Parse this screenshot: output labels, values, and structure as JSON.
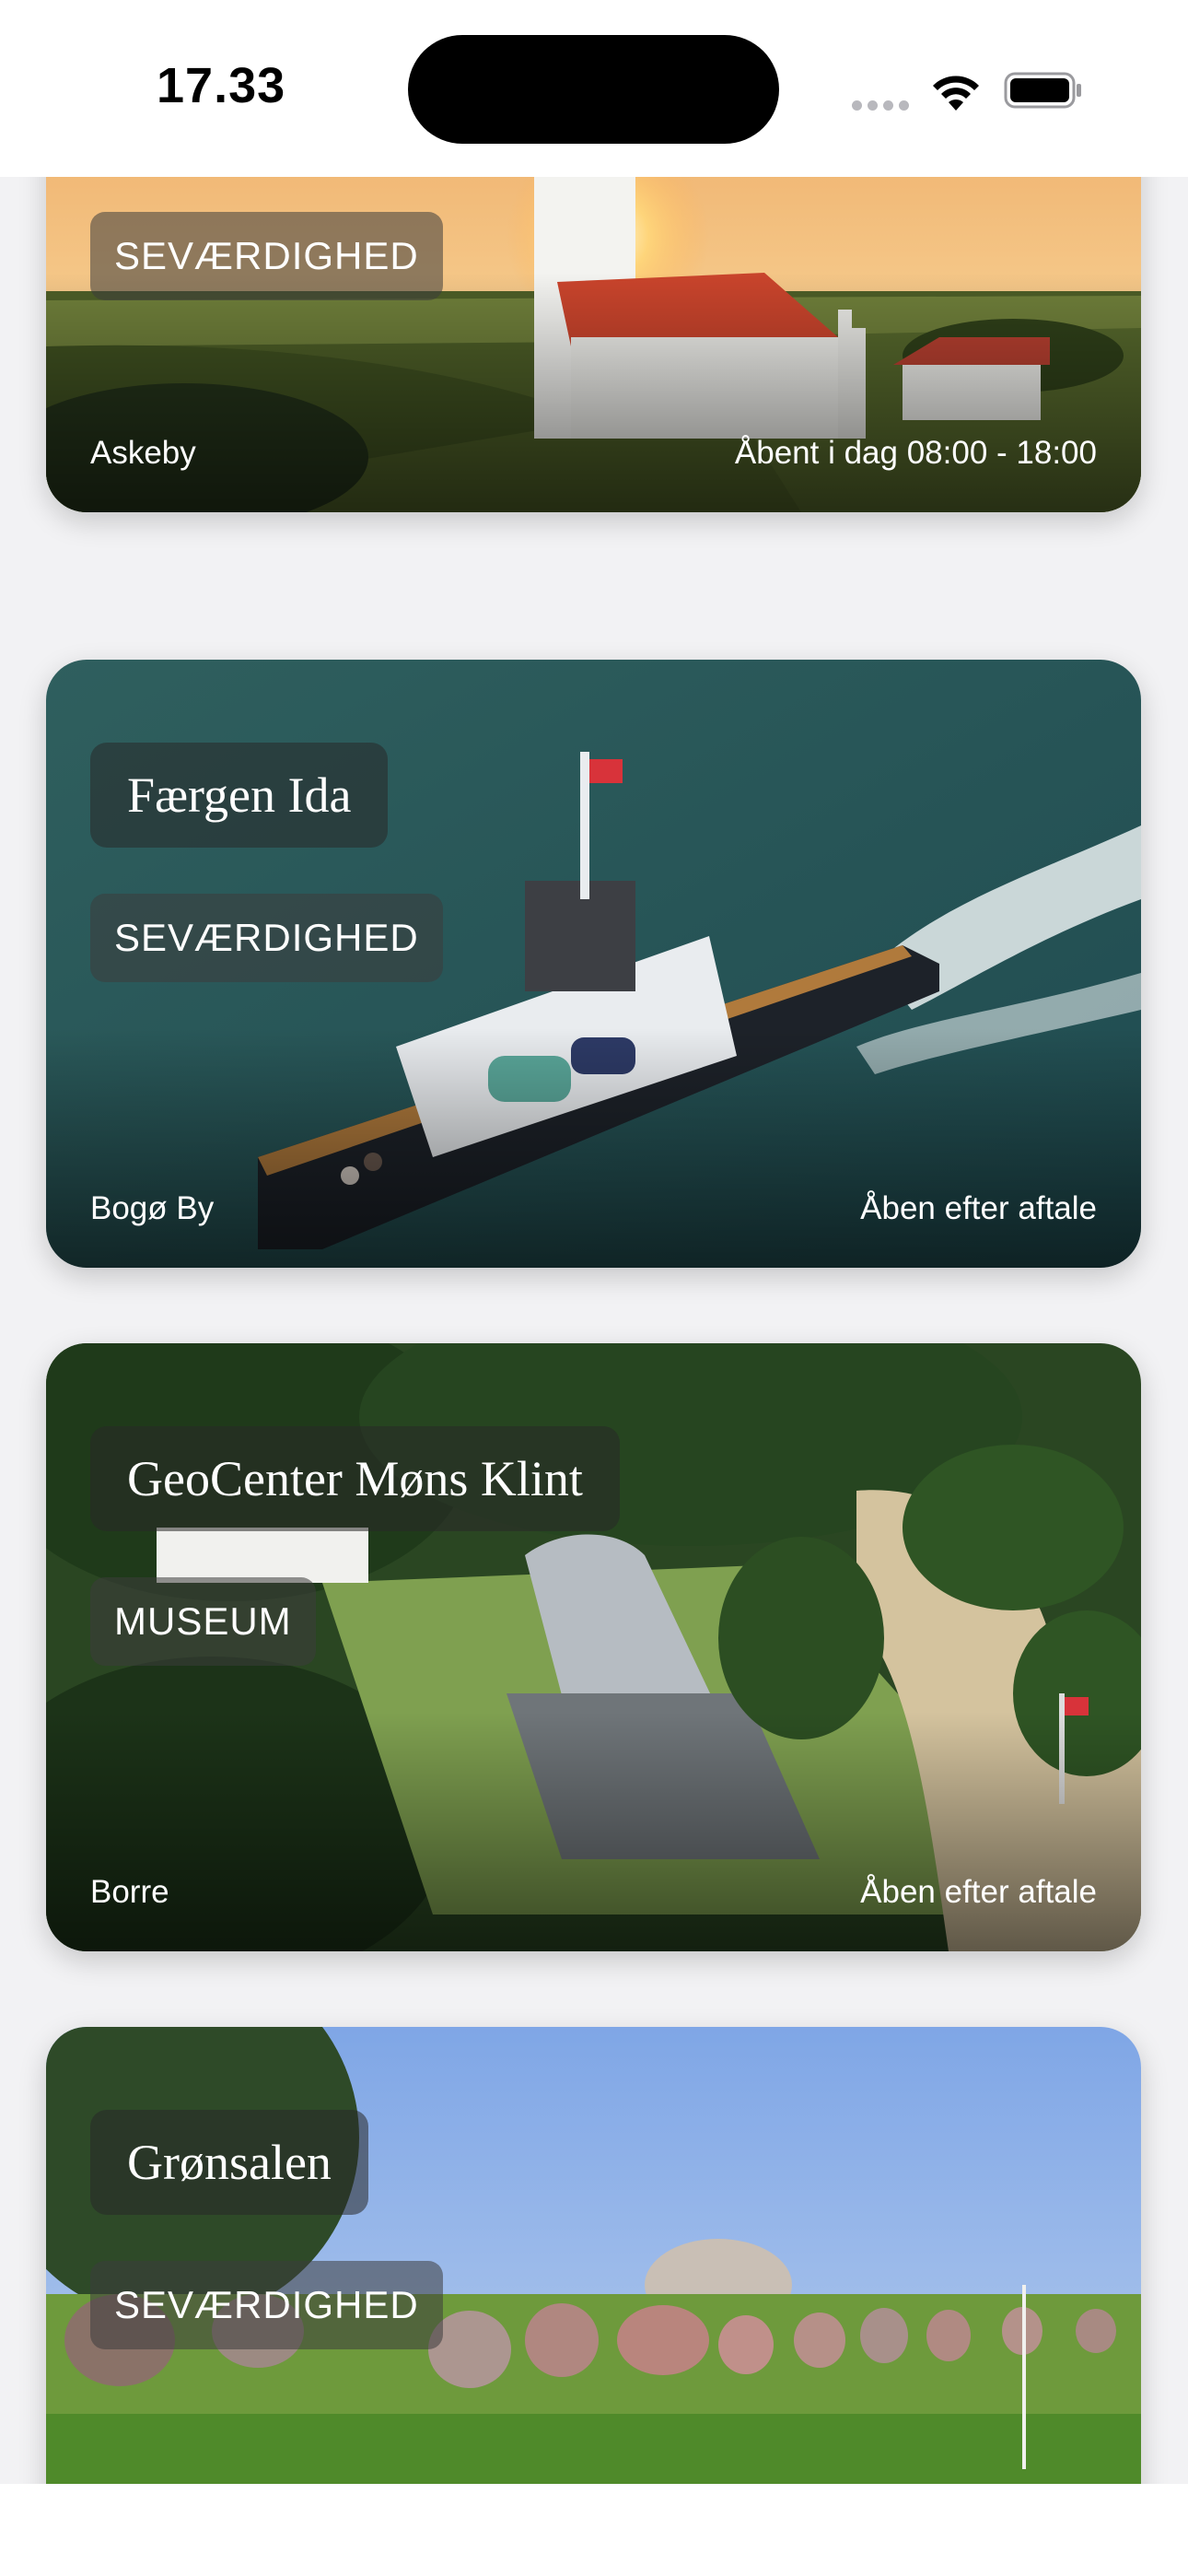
{
  "status_bar": {
    "time": "17.33"
  },
  "cards": [
    {
      "title": "",
      "category": "SEVÆRDIGHED",
      "location": "Askeby",
      "hours": "Åbent i dag 08:00 - 18:00"
    },
    {
      "title": "Færgen Ida",
      "category": "SEVÆRDIGHED",
      "location": "Bogø By",
      "hours": "Åben efter aftale"
    },
    {
      "title": "GeoCenter Møns Klint",
      "category": "MUSEUM",
      "location": "Borre",
      "hours": "Åben efter aftale"
    },
    {
      "title": "Grønsalen",
      "category": "SEVÆRDIGHED",
      "location": "",
      "hours": ""
    }
  ],
  "icons": [
    "cellular-signal-icon",
    "wifi-icon",
    "battery-icon"
  ],
  "colors": {
    "background": "#f2f2f4",
    "status_bar": "#ffffff"
  }
}
